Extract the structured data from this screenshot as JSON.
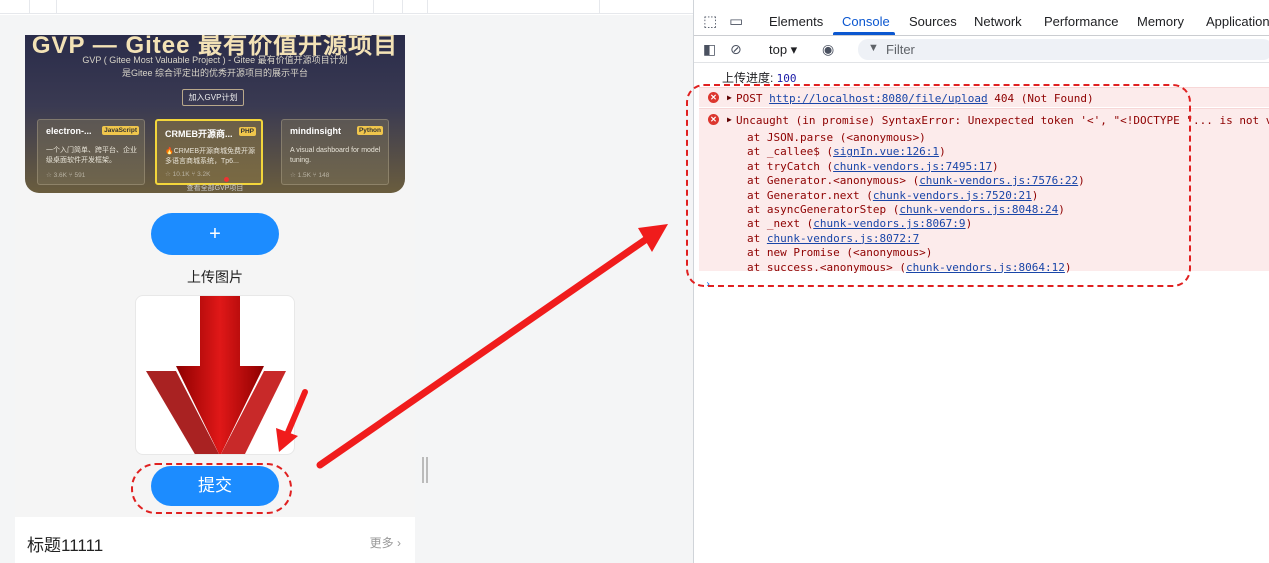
{
  "preview": {
    "banner": {
      "title": "GVP — Gitee 最有价值开源项目",
      "line1": "GVP ( Gitee Most Valuable Project ) - Gitee 最有价值开源项目计划",
      "line2": "是Gitee 综合评定出的优秀开源项目的展示平台",
      "join_label": "加入GVP计划",
      "more_label": "查看全部GVP项目",
      "projects": [
        {
          "name": "electron-...",
          "lang": "JavaScript",
          "desc": "一个入门简单、跨平台、企业级桌面软件开发框架。",
          "stats": "☆ 3.6K   ⑂ 591"
        },
        {
          "name": "CRMEB开源商...",
          "lang": "PHP",
          "desc": "🔥CRMEB开源商城免费开源多语言商城系统，Tp6...",
          "stats": "☆ 10.1K   ⑂ 3.2K"
        },
        {
          "name": "mindinsight",
          "lang": "Python",
          "desc": "A visual dashboard for model tuning.",
          "stats": "☆ 1.5K   ⑂ 148"
        }
      ]
    },
    "plus_label": "+",
    "upload_label": "上传图片",
    "submit_label": "提交",
    "section_title": "标题11111",
    "section_more": "更多 ›"
  },
  "devtools": {
    "tabs": [
      "Elements",
      "Console",
      "Sources",
      "Network",
      "Performance",
      "Memory",
      "Application"
    ],
    "active_tab": "Console",
    "context": "top ▾",
    "filter_placeholder": "Filter",
    "log": {
      "label": "上传进度: ",
      "value": "100"
    },
    "error1": {
      "prefix": "POST ",
      "url": "http://localhost:8080/file/upload",
      "suffix": " 404 (Not Found)"
    },
    "error2": {
      "message": "Uncaught (in promise) SyntaxError: Unexpected token '<', \"<!DOCTYPE \"... is not valid JSON",
      "stack": [
        {
          "text": "at JSON.parse (<anonymous>)",
          "link": ""
        },
        {
          "text": "at _callee$ (",
          "link": "signIn.vue:126:1",
          "end": ")"
        },
        {
          "text": "at tryCatch (",
          "link": "chunk-vendors.js:7495:17",
          "end": ")"
        },
        {
          "text": "at Generator.<anonymous> (",
          "link": "chunk-vendors.js:7576:22",
          "end": ")"
        },
        {
          "text": "at Generator.next (",
          "link": "chunk-vendors.js:7520:21",
          "end": ")"
        },
        {
          "text": "at asyncGeneratorStep (",
          "link": "chunk-vendors.js:8048:24",
          "end": ")"
        },
        {
          "text": "at _next (",
          "link": "chunk-vendors.js:8067:9",
          "end": ")"
        },
        {
          "text": "at ",
          "link": "chunk-vendors.js:8072:7",
          "end": ""
        },
        {
          "text": "at new Promise (<anonymous>)",
          "link": ""
        },
        {
          "text": "at success.<anonymous> (",
          "link": "chunk-vendors.js:8064:12",
          "end": ")"
        }
      ]
    }
  },
  "colors": {
    "accent": "#1c8cff",
    "error_bg": "#fcebeb",
    "annotation": "#e02020",
    "devtools_active": "#0b57d0"
  }
}
